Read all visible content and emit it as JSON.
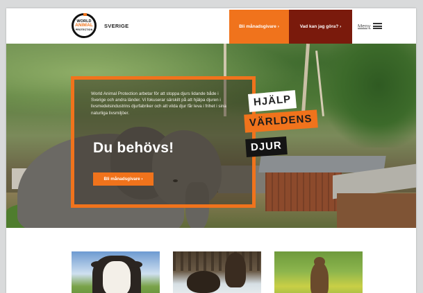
{
  "header": {
    "logo_line1": "WORLD",
    "logo_line2": "ANIMAL",
    "logo_line3": "PROTECTION",
    "country": "SVERIGE",
    "monthly_button": "Bli månadsgivare ›",
    "what_button": "Vad kan jag göra? ›",
    "menu_label": "Meny"
  },
  "hero": {
    "intro": "World Animal Protection arbetar för att stoppa djurs lidande både i Sverige och andra länder. Vi fokuserar särskilt på att hjälpa djuren i livsmedelsindustrins djurfabriker och att vilda djur får leva i frihet i sina naturliga livsmiljöer.",
    "heading": "Du behövs!",
    "cta": "Bli månadsgivare ›",
    "tagline": [
      "HJÄLP",
      "VÄRLDENS",
      "DJUR"
    ]
  },
  "thumbnails": [
    {
      "subject": "cow"
    },
    {
      "subject": "bears-in-snow"
    },
    {
      "subject": "bear-in-meadow"
    }
  ],
  "colors": {
    "accent_orange": "#f0731c",
    "dark_red": "#7a1a0c",
    "black": "#141414"
  }
}
